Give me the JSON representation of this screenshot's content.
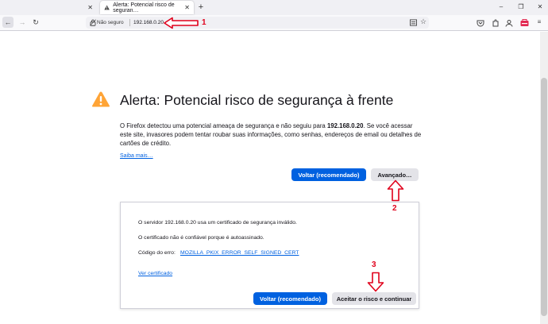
{
  "tabs": [
    {
      "label": "",
      "close": "✕"
    },
    {
      "label": "Alerta: Potencial risco de seguran…",
      "close": "✕"
    }
  ],
  "new_tab": "+",
  "window_controls": {
    "minimize": "–",
    "maximize": "❐",
    "close": "✕"
  },
  "nav": {
    "back": "←",
    "forward": "→",
    "reload": "↻"
  },
  "urlbar": {
    "security_label": "Não seguro",
    "url": "192.168.0.20"
  },
  "toolbar_icons": [
    "reader-view-icon",
    "star-icon",
    "pocket-icon",
    "extensions-icon",
    "account-icon",
    "container-icon",
    "menu-icon"
  ],
  "page": {
    "title": "Alerta: Potencial risco de segurança à frente",
    "description_pre": "O Firefox detectou uma potencial ameaça de segurança e não seguiu para ",
    "description_host": "192.168.0.20",
    "description_post": ". Se você acessar este site, invasores podem tentar roubar suas informações, como senhas, endereços de email ou detalhes de cartões de crédito.",
    "learn_more": "Saiba mais…",
    "back_button": "Voltar (recomendado)",
    "advanced_button": "Avançado…"
  },
  "advanced": {
    "line1": "O servidor 192.168.0.20 usa um certificado de segurança inválido.",
    "line2": "O certificado não é confiável porque é autoassinado.",
    "error_label": "Código do erro:",
    "error_code": "MOZILLA_PKIX_ERROR_SELF_SIGNED_CERT",
    "view_certificate": "Ver certificado",
    "back_button": "Voltar (recomendado)",
    "accept_button": "Aceitar o risco e continuar"
  },
  "annotations": {
    "n1": "1",
    "n2": "2",
    "n3": "3"
  },
  "colors": {
    "accent": "#0061e0",
    "warning": "#ffa436",
    "annotation": "#e0001b"
  }
}
